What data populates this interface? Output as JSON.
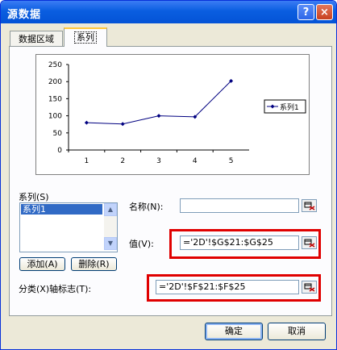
{
  "window": {
    "title": "源数据",
    "help_glyph": "?",
    "close_glyph": "×"
  },
  "tabs": [
    {
      "label": "数据区域"
    },
    {
      "label": "系列"
    }
  ],
  "chart_data": {
    "type": "line",
    "categories": [
      "1",
      "2",
      "3",
      "4",
      "5"
    ],
    "series": [
      {
        "name": "系列1",
        "values": [
          80,
          76,
          100,
          97,
          202
        ],
        "color": "#000080"
      }
    ],
    "ylim": [
      0,
      250
    ],
    "yticks": [
      "0",
      "50",
      "100",
      "150",
      "200",
      "250"
    ],
    "legend": "right"
  },
  "series_panel": {
    "label": "系列(S)",
    "items": [
      "系列1"
    ],
    "add_button": "添加(A)",
    "delete_button": "删除(R)"
  },
  "fields": {
    "name_label": "名称(N):",
    "name_value": "",
    "value_label": "值(V):",
    "value_value": "='2D'!$G$21:$G$25",
    "category_label": "分类(X)轴标志(T):",
    "category_value": "='2D'!$F$21:$F$25"
  },
  "buttons": {
    "ok": "确定",
    "cancel": "取消"
  },
  "colors": {
    "highlight_box": "#e00000",
    "selection": "#316ac5",
    "titlebar": "#0a5ee0"
  }
}
